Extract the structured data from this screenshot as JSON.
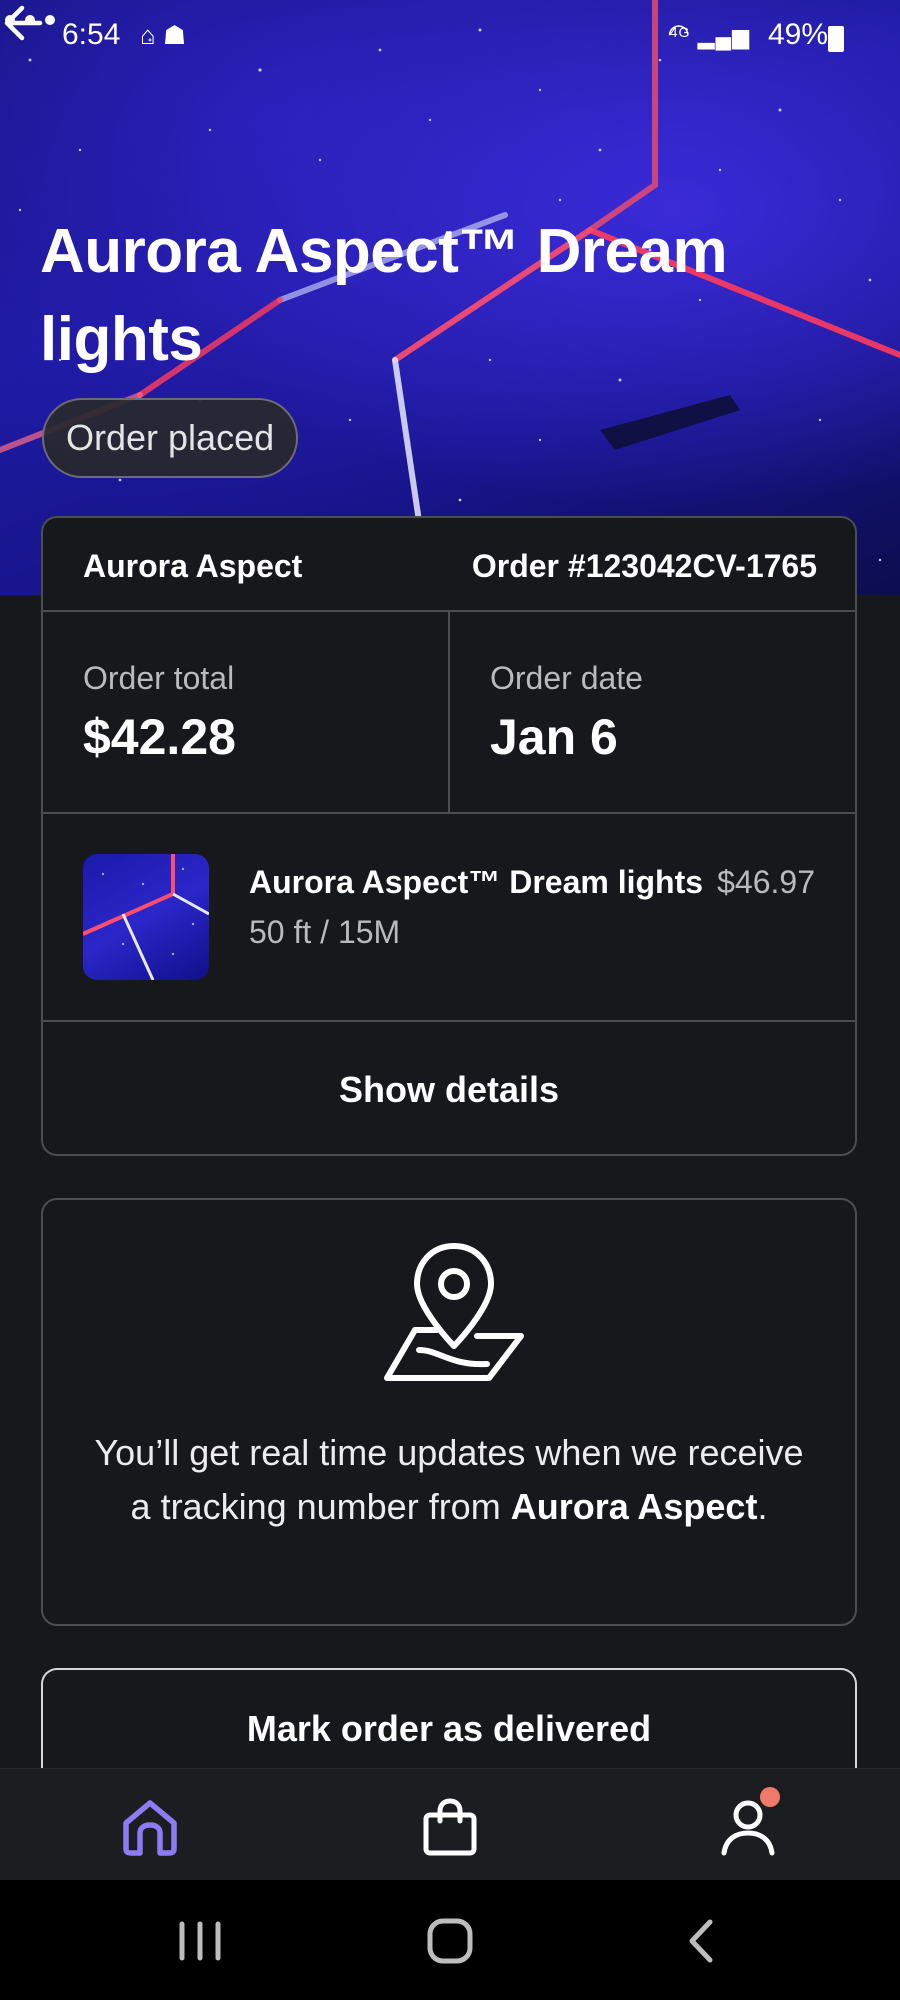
{
  "status_bar": {
    "time": "6:54",
    "battery": "49%",
    "network": "4G"
  },
  "header": {
    "title": "Aurora Aspect™ Dream lights",
    "status": "Order placed",
    "back_icon": "arrow-left-icon",
    "more_icon": "more-horizontal-icon"
  },
  "order": {
    "merchant": "Aurora Aspect",
    "number": "Order #123042CV-1765",
    "total_label": "Order total",
    "total_value": "$42.28",
    "date_label": "Order date",
    "date_value": "Jan 6",
    "item": {
      "name": "Aurora Aspect™ Dream lights",
      "price": "$46.97",
      "variant": "50 ft / 15M"
    },
    "show_details": "Show details"
  },
  "tracking": {
    "icon": "map-pin-icon",
    "text_prefix": "You’ll get real time updates when we receive a tracking number from ",
    "merchant": "Aurora Aspect",
    "text_suffix": "."
  },
  "actions": {
    "mark_delivered": "Mark order as delivered"
  },
  "bottom_nav": {
    "items": [
      {
        "icon": "home-icon",
        "active": true
      },
      {
        "icon": "shopping-bag-icon",
        "active": false
      },
      {
        "icon": "profile-icon",
        "active": false,
        "notification": true
      }
    ]
  },
  "colors": {
    "background": "#17181b",
    "accent": "#8b7cf6",
    "notification": "#f07a6a",
    "border": "#4b4d52"
  }
}
